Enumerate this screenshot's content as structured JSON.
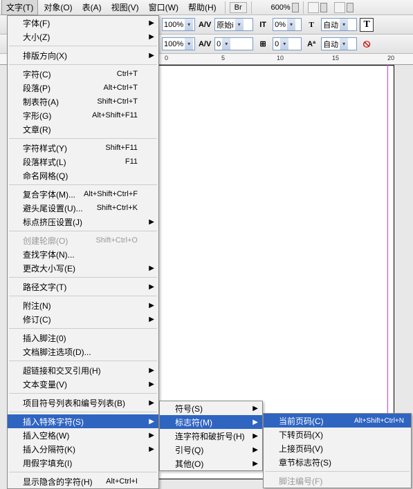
{
  "menubar": {
    "items": [
      {
        "label": "文字(T)"
      },
      {
        "label": "对象(O)"
      },
      {
        "label": "表(A)"
      },
      {
        "label": "视图(V)"
      },
      {
        "label": "窗口(W)"
      },
      {
        "label": "帮助(H)"
      }
    ],
    "br": "Br",
    "zoom": "600%"
  },
  "toolbar": {
    "row1": {
      "pct1": "100%",
      "av_label": "A/V",
      "av_value": "原始i",
      "it_icon": "IT",
      "it_value": "0%",
      "t_icon": "T",
      "t_value": "自动",
      "ticon": "T"
    },
    "row2": {
      "pct2": "100%",
      "av_label2": "A/V",
      "av_value2": "0",
      "lh_value": "0",
      "a_icon": "Aª",
      "a_value": "自动",
      "nored": "⦸"
    }
  },
  "ruler": {
    "t0": "0",
    "t5": "5",
    "t10": "10",
    "t15": "15",
    "t20": "20"
  },
  "menu1": [
    {
      "label": "字体(F)",
      "arrow": true
    },
    {
      "label": "大小(Z)",
      "arrow": true
    },
    {
      "sep": true
    },
    {
      "label": "排版方向(X)",
      "arrow": true
    },
    {
      "sep": true
    },
    {
      "label": "字符(C)",
      "shortcut": "Ctrl+T"
    },
    {
      "label": "段落(P)",
      "shortcut": "Alt+Ctrl+T"
    },
    {
      "label": "制表符(A)",
      "shortcut": "Shift+Ctrl+T"
    },
    {
      "label": "字形(G)",
      "shortcut": "Alt+Shift+F11"
    },
    {
      "label": "文章(R)"
    },
    {
      "sep": true
    },
    {
      "label": "字符样式(Y)",
      "shortcut": "Shift+F11"
    },
    {
      "label": "段落样式(L)",
      "shortcut": "F11"
    },
    {
      "label": "命名网格(Q)"
    },
    {
      "sep": true
    },
    {
      "label": "复合字体(M)...",
      "shortcut": "Alt+Shift+Ctrl+F"
    },
    {
      "label": "避头尾设置(U)...",
      "shortcut": "Shift+Ctrl+K"
    },
    {
      "label": "标点挤压设置(J)",
      "arrow": true
    },
    {
      "sep": true
    },
    {
      "label": "创建轮廓(O)",
      "shortcut": "Shift+Ctrl+O",
      "disabled": true
    },
    {
      "label": "查找字体(N)..."
    },
    {
      "label": "更改大小写(E)",
      "arrow": true
    },
    {
      "sep": true
    },
    {
      "label": "路径文字(T)",
      "arrow": true
    },
    {
      "sep": true
    },
    {
      "label": "附注(N)",
      "arrow": true
    },
    {
      "label": "修订(C)",
      "arrow": true
    },
    {
      "sep": true
    },
    {
      "label": "插入脚注(0)"
    },
    {
      "label": "文档脚注选项(D)..."
    },
    {
      "sep": true
    },
    {
      "label": "超链接和交叉引用(H)",
      "arrow": true
    },
    {
      "label": "文本变量(V)",
      "arrow": true
    },
    {
      "sep": true
    },
    {
      "label": "项目符号列表和编号列表(B)",
      "arrow": true
    },
    {
      "sep": true
    },
    {
      "label": "插入特殊字符(S)",
      "arrow": true,
      "hl": true
    },
    {
      "label": "插入空格(W)",
      "arrow": true
    },
    {
      "label": "插入分隔符(K)",
      "arrow": true
    },
    {
      "label": "用假字填充(I)"
    },
    {
      "sep": true
    },
    {
      "label": "显示隐含的字符(H)",
      "shortcut": "Alt+Ctrl+I"
    }
  ],
  "menu2": [
    {
      "label": "符号(S)",
      "arrow": true
    },
    {
      "label": "标志符(M)",
      "arrow": true,
      "hl": true
    },
    {
      "label": "连字符和破折号(H)",
      "arrow": true
    },
    {
      "label": "引号(Q)",
      "arrow": true
    },
    {
      "label": "其他(O)",
      "arrow": true
    }
  ],
  "menu3": [
    {
      "label": "当前页码(C)",
      "shortcut": "Alt+Shift+Ctrl+N",
      "hl": true
    },
    {
      "label": "下转页码(X)"
    },
    {
      "label": "上接页码(V)"
    },
    {
      "label": "章节标志符(S)"
    },
    {
      "sep": true
    },
    {
      "label": "脚注编号(F)",
      "disabled": true
    }
  ]
}
